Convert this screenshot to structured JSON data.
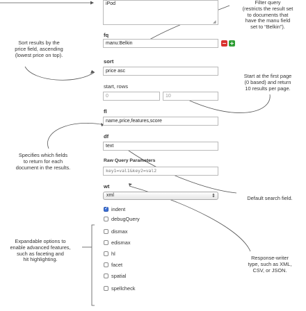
{
  "fields": {
    "q_value": "iPod",
    "fq_label": "fq",
    "fq_value": "manu:Belkin",
    "fq_remove": "−",
    "fq_add": "+",
    "sort_label": "sort",
    "sort_value": "price asc",
    "start_rows_label": "start, rows",
    "start_value": "0",
    "rows_value": "10",
    "fl_label": "fl",
    "fl_value": "name,price,features,score",
    "df_label": "df",
    "df_value": "text",
    "raw_label": "Raw Query Parameters",
    "raw_placeholder": "key1=val1&key2=val2",
    "wt_label": "wt",
    "wt_value": "xml",
    "wt_arrow": "⇕"
  },
  "checkboxes": {
    "indent": {
      "label": "indent",
      "checked": true
    },
    "debugQuery": {
      "label": "debugQuery",
      "checked": false
    },
    "dismax": {
      "label": "dismax",
      "checked": false
    },
    "edismax": {
      "label": "edismax",
      "checked": false
    },
    "hl": {
      "label": "hl",
      "checked": false
    },
    "facet": {
      "label": "facet",
      "checked": false
    },
    "spatial": {
      "label": "spatial",
      "checked": false
    },
    "spellcheck": {
      "label": "spellcheck",
      "checked": false
    }
  },
  "annotations": {
    "sort_note": "Sort results by the\nprice field, ascending\n(lowest price on top).",
    "fq_note": "Filter query\n(restricts the result set\nto documents that\nhave the manu field\nset to “Belkin”).",
    "start_rows_note": "Start at the first page\n(0 based) and return\n10 results per page.",
    "fl_note": "Specifies which fields\nto return for each\ndocument in the results.",
    "df_note": "Default search field.",
    "options_note": "Expandable options to\nenable advanced features,\nsuch as faceting and\nhit highlighting.",
    "wt_note": "Response-writer\ntype, such as XML,\nCSV, or JSON."
  }
}
